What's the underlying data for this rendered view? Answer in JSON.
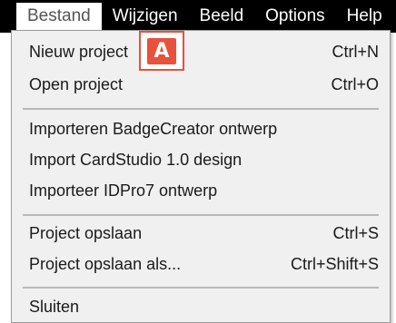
{
  "menubar": {
    "items": [
      {
        "label": "Bestand"
      },
      {
        "label": "Wijzigen"
      },
      {
        "label": "Beeld"
      },
      {
        "label": "Options"
      },
      {
        "label": "Help"
      }
    ]
  },
  "menu": {
    "items": [
      {
        "label": "Nieuw project",
        "shortcut": "Ctrl+N"
      },
      {
        "label": "Open project",
        "shortcut": "Ctrl+O"
      },
      {
        "label": "Importeren BadgeCreator ontwerp",
        "shortcut": ""
      },
      {
        "label": "Import CardStudio 1.0 design",
        "shortcut": ""
      },
      {
        "label": "Importeer IDPro7 ontwerp",
        "shortcut": ""
      },
      {
        "label": "Project opslaan",
        "shortcut": "Ctrl+S"
      },
      {
        "label": "Project opslaan als...",
        "shortcut": "Ctrl+Shift+S"
      },
      {
        "label": "Sluiten",
        "shortcut": ""
      }
    ]
  },
  "annotation": {
    "label": "A"
  },
  "colors": {
    "accent": "#e8513c",
    "menubar": "#000000",
    "menu_bg": "#f0f0f0"
  }
}
